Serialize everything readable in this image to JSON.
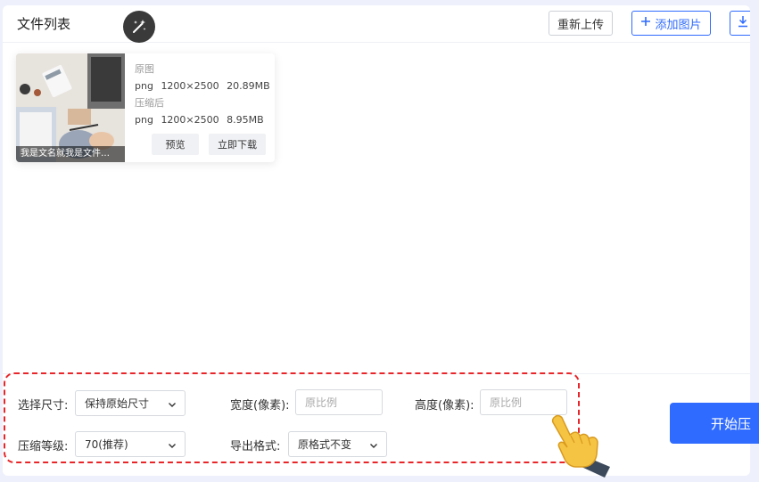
{
  "header": {
    "title": "文件列表",
    "reupload_label": "重新上传",
    "add_image_label": "添加图片"
  },
  "file_card": {
    "thumbnail_name": "我是文名就我是文件…",
    "original_label": "原图",
    "original_format": "png",
    "original_dimensions": "1200×2500",
    "original_size": "20.89MB",
    "compressed_label": "压缩后",
    "compressed_format": "png",
    "compressed_dimensions": "1200×2500",
    "compressed_size": "8.95MB",
    "preview_label": "预览",
    "download_label": "立即下载"
  },
  "settings": {
    "size_label": "选择尺寸:",
    "size_value": "保持原始尺寸",
    "width_label": "宽度(像素):",
    "width_placeholder": "原比例",
    "height_label": "高度(像素):",
    "height_placeholder": "原比例",
    "level_label": "压缩等级:",
    "level_value": "70(推荐)",
    "format_label": "导出格式:",
    "format_value": "原格式不变"
  },
  "actions": {
    "start_label": "开始压"
  },
  "colors": {
    "primary": "#2f6bff",
    "highlight_border": "#e8262a",
    "background": "#eef1fb"
  },
  "icons": [
    "magic-wand-icon",
    "plus-icon",
    "download-icon",
    "chevron-down-icon",
    "pointing-hand-icon"
  ]
}
